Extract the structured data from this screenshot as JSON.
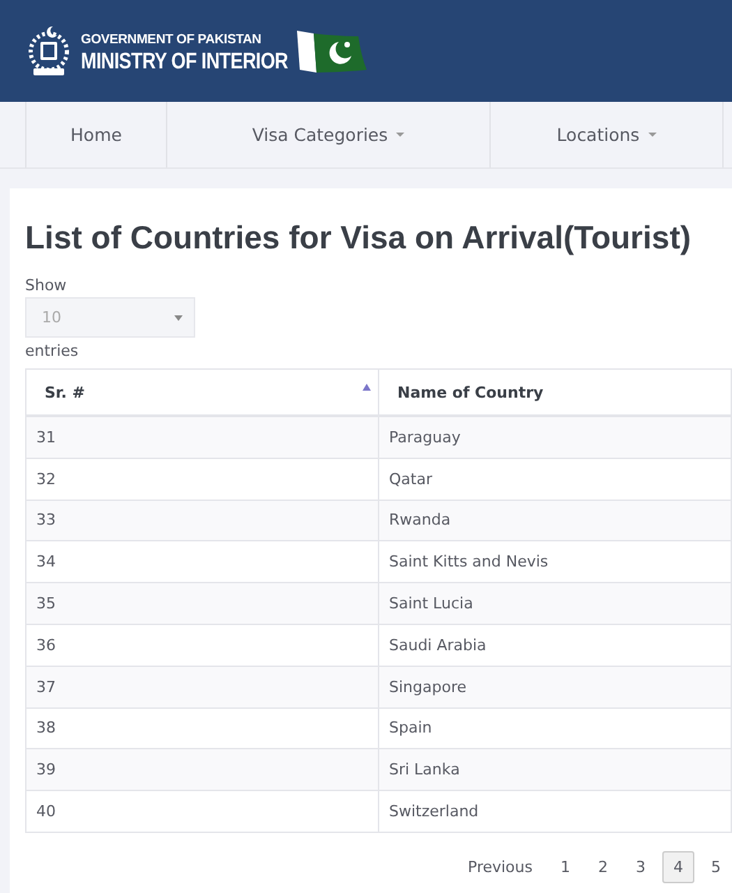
{
  "header": {
    "line_1": "GOVERNMENT OF PAKISTAN",
    "line_2": "MINISTRY OF INTERIOR"
  },
  "nav": [
    {
      "label": "Home",
      "dropdown": false
    },
    {
      "label": "Visa Categories",
      "dropdown": true
    },
    {
      "label": "Locations",
      "dropdown": true
    }
  ],
  "title": "List of Countries for Visa on Arrival(Tourist)",
  "length_menu": {
    "before": "Show",
    "value": "10",
    "after": "entries"
  },
  "table": {
    "columns": [
      {
        "label": "Sr. #",
        "sorted_ascending": true
      },
      {
        "label": "Name of Country",
        "sorted_ascending": false
      }
    ],
    "rows": [
      [
        "31",
        "Paraguay"
      ],
      [
        "32",
        "Qatar"
      ],
      [
        "33",
        "Rwanda"
      ],
      [
        "34",
        "Saint Kitts and Nevis"
      ],
      [
        "35",
        "Saint Lucia"
      ],
      [
        "36",
        "Saudi Arabia"
      ],
      [
        "37",
        "Singapore"
      ],
      [
        "38",
        "Spain"
      ],
      [
        "39",
        "Sri Lanka"
      ],
      [
        "40",
        "Switzerland"
      ]
    ]
  },
  "pagination": {
    "previous": "Previous",
    "pages": [
      {
        "label": "1",
        "selected": false
      },
      {
        "label": "2",
        "selected": false
      },
      {
        "label": "3",
        "selected": false
      },
      {
        "label": "4",
        "selected": true
      },
      {
        "label": "5",
        "selected": false
      }
    ]
  }
}
